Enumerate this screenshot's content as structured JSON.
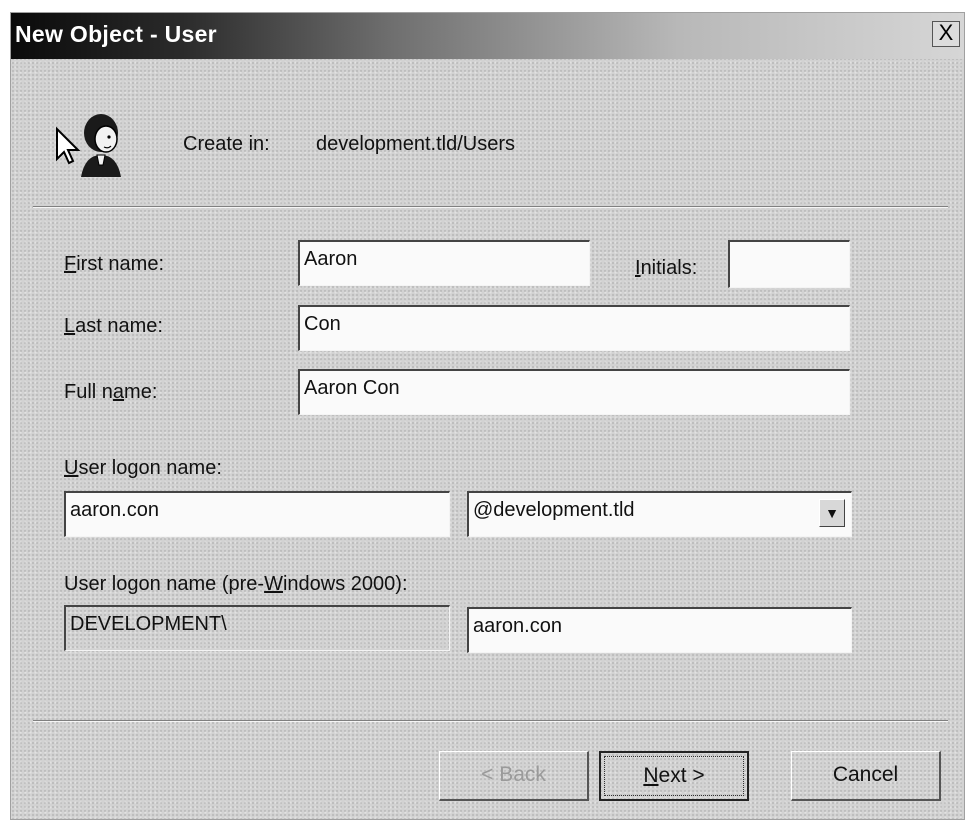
{
  "window": {
    "title": "New Object - User",
    "close_glyph": "X"
  },
  "header": {
    "icon": "user-icon",
    "create_in_label": "Create in:",
    "create_in_value": "development.tld/Users"
  },
  "form": {
    "first_name": {
      "mnemonic": "F",
      "rest": "irst name:",
      "value": "Aaron"
    },
    "initials": {
      "mnemonic": "I",
      "rest": "nitials:",
      "value": ""
    },
    "last_name": {
      "mnemonic": "L",
      "rest": "ast name:",
      "value": "Con"
    },
    "full_name": {
      "before": "Full n",
      "mnemonic": "a",
      "after": "me:",
      "value": "Aaron Con"
    },
    "logon_name": {
      "mnemonic": "U",
      "rest": "ser logon name:",
      "value": "aaron.con"
    },
    "domain_suffix": {
      "value": "@development.tld"
    },
    "pre2000": {
      "before": "User logon name (pre-",
      "mnemonic": "W",
      "after": "indows 2000):",
      "domain_value": "DEVELOPMENT\\",
      "user_value": "aaron.con"
    }
  },
  "buttons": {
    "back": "< Back",
    "next_mnemonic": "N",
    "next_rest": "ext >",
    "cancel": "Cancel"
  }
}
